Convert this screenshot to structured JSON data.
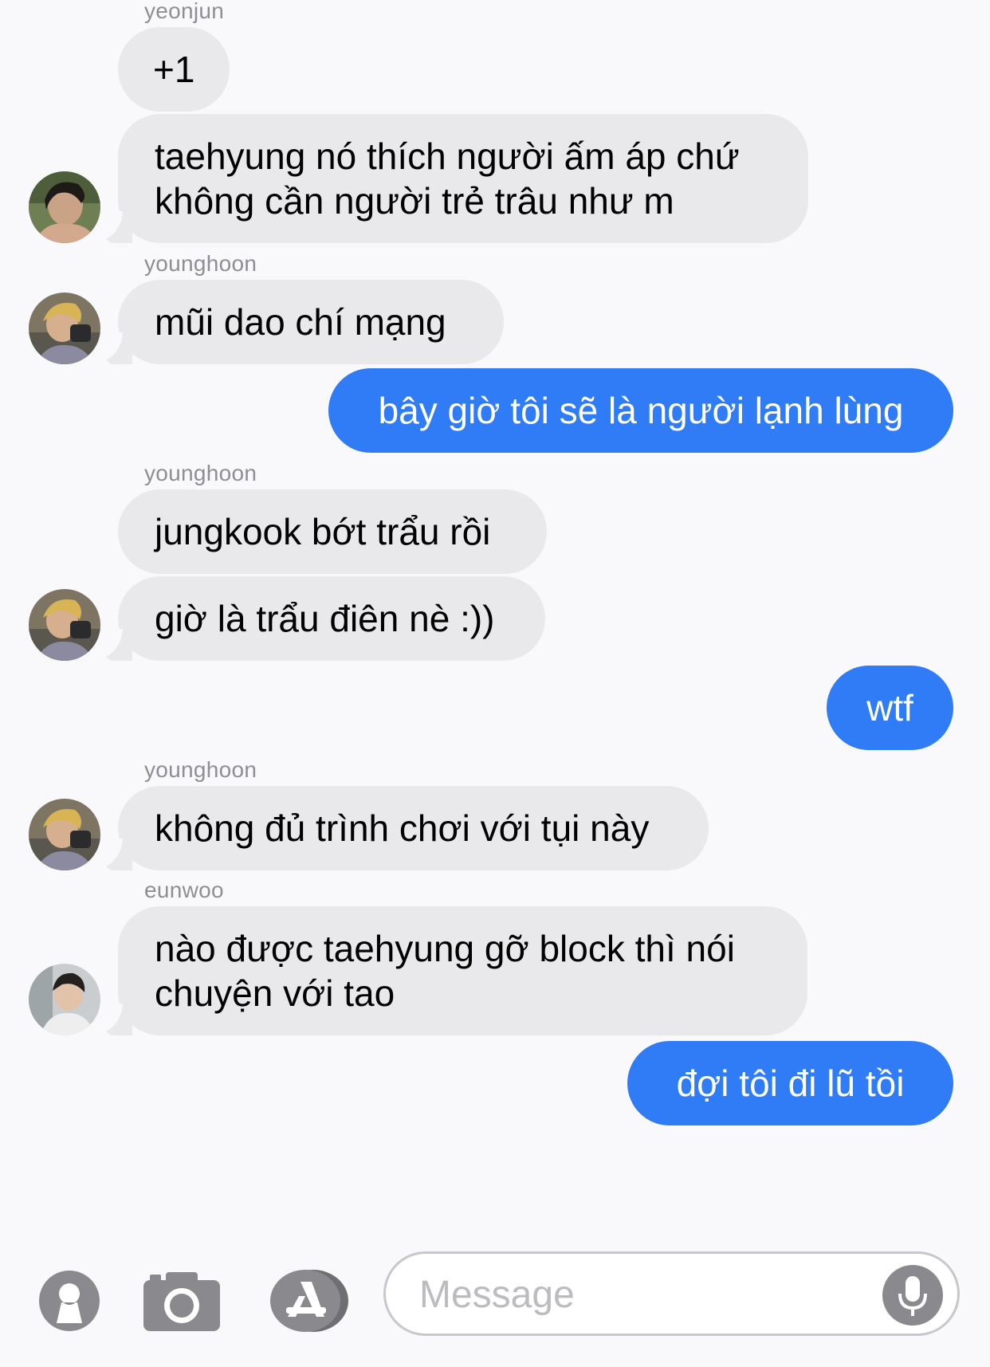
{
  "messages": [
    {
      "sender": "yeonjun",
      "text": "+1"
    },
    {
      "line1": "taehyung nó thích người ấm áp chứ",
      "line2": "không cần người trẻ trâu như m"
    },
    {
      "sender": "younghoon",
      "text": "mũi dao chí mạng"
    },
    {
      "text": "bây giờ tôi sẽ là người lạnh lùng"
    },
    {
      "sender": "younghoon",
      "text": "jungkook bớt trẩu rồi"
    },
    {
      "text": "giờ là trẩu điên nè :))"
    },
    {
      "text": "wtf"
    },
    {
      "sender": "younghoon",
      "text": "không đủ trình chơi với tụi này"
    },
    {
      "sender": "eunwoo",
      "line1": "nào được taehyung gỡ block thì nói",
      "line2": "chuyện với tao"
    },
    {
      "text": "đợi tôi đi lũ tồi"
    }
  ],
  "composer": {
    "placeholder": "Message",
    "icons": [
      "contact-icon",
      "camera-icon",
      "app-store-icon",
      "microphone-icon"
    ]
  },
  "colors": {
    "outgoing_bubble": "#2f7cf6",
    "incoming_bubble": "#e9e9eb",
    "sender_label": "#8e8e93",
    "background": "#f9f9fb"
  }
}
